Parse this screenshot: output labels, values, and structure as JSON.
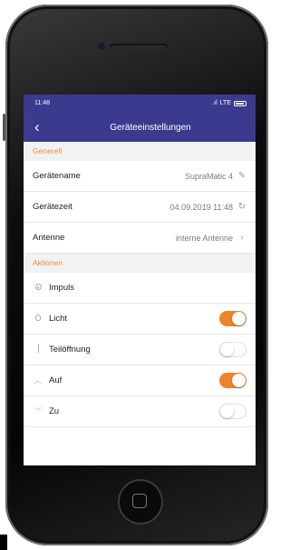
{
  "status_bar": {
    "time": "11:48",
    "network": "LTE"
  },
  "nav": {
    "back_label": "‹",
    "title": "Geräteeinstellungen"
  },
  "sections": {
    "general": "Generell",
    "actions": "Aktionen"
  },
  "general_rows": [
    {
      "label": "Gerätename",
      "value": "SupraMatic 4",
      "tail_icon": "pencil-icon"
    },
    {
      "label": "Gerätezeit",
      "value": "04.09.2019 11:48",
      "tail_icon": "sync-icon"
    },
    {
      "label": "Antenne",
      "value": "interne Antenne",
      "tail_icon": "chevron-right-icon"
    }
  ],
  "action_rows": [
    {
      "label": "Impuls",
      "icon": "radio-icon"
    },
    {
      "label": "Licht",
      "icon": "bulb-icon",
      "on": true
    },
    {
      "label": "Teilöffnung",
      "icon": "partial-open-icon",
      "on": false
    },
    {
      "label": "Auf",
      "icon": "chevron-up-icon",
      "on": true
    },
    {
      "label": "Zu",
      "icon": "chevron-down-icon",
      "on": false
    }
  ],
  "colors": {
    "navbar": "#3b3a8f",
    "accent": "#f08a3e",
    "toggle_on": "#f0822a"
  }
}
